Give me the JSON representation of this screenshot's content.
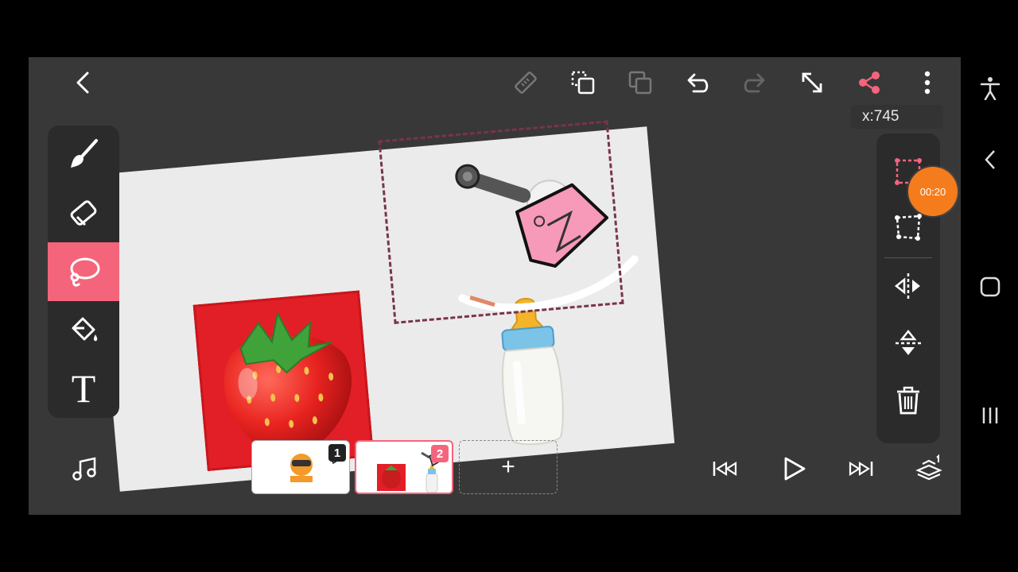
{
  "toolbar": {
    "back": "back-icon",
    "ruler": "ruler-icon",
    "duplicate": "duplicate-icon",
    "copy": "copy-icon",
    "undo": "undo-icon",
    "redo": "redo-icon",
    "resize": "resize-icon",
    "share": "share-icon",
    "more": "more-vertical-icon"
  },
  "coordinate_readout": "x:745",
  "timer": "00:20",
  "tools": [
    {
      "name": "brush",
      "active": false
    },
    {
      "name": "eraser",
      "active": false
    },
    {
      "name": "lasso",
      "active": true
    },
    {
      "name": "fill",
      "active": false
    },
    {
      "name": "text",
      "active": false
    }
  ],
  "text_tool_glyph": "T",
  "transform_tools": [
    "select-rect",
    "distort",
    "flip-horizontal",
    "flip-vertical",
    "delete"
  ],
  "playback": [
    "skip-to-start",
    "play",
    "skip-to-end",
    "onion-skin"
  ],
  "frames": [
    {
      "number": "1",
      "selected": false
    },
    {
      "number": "2",
      "selected": true
    }
  ],
  "add_frame_label": "+",
  "colors": {
    "accent": "#f4657c",
    "panel": "#2b2b2b",
    "background": "#383838",
    "timer": "#f57c1c"
  }
}
